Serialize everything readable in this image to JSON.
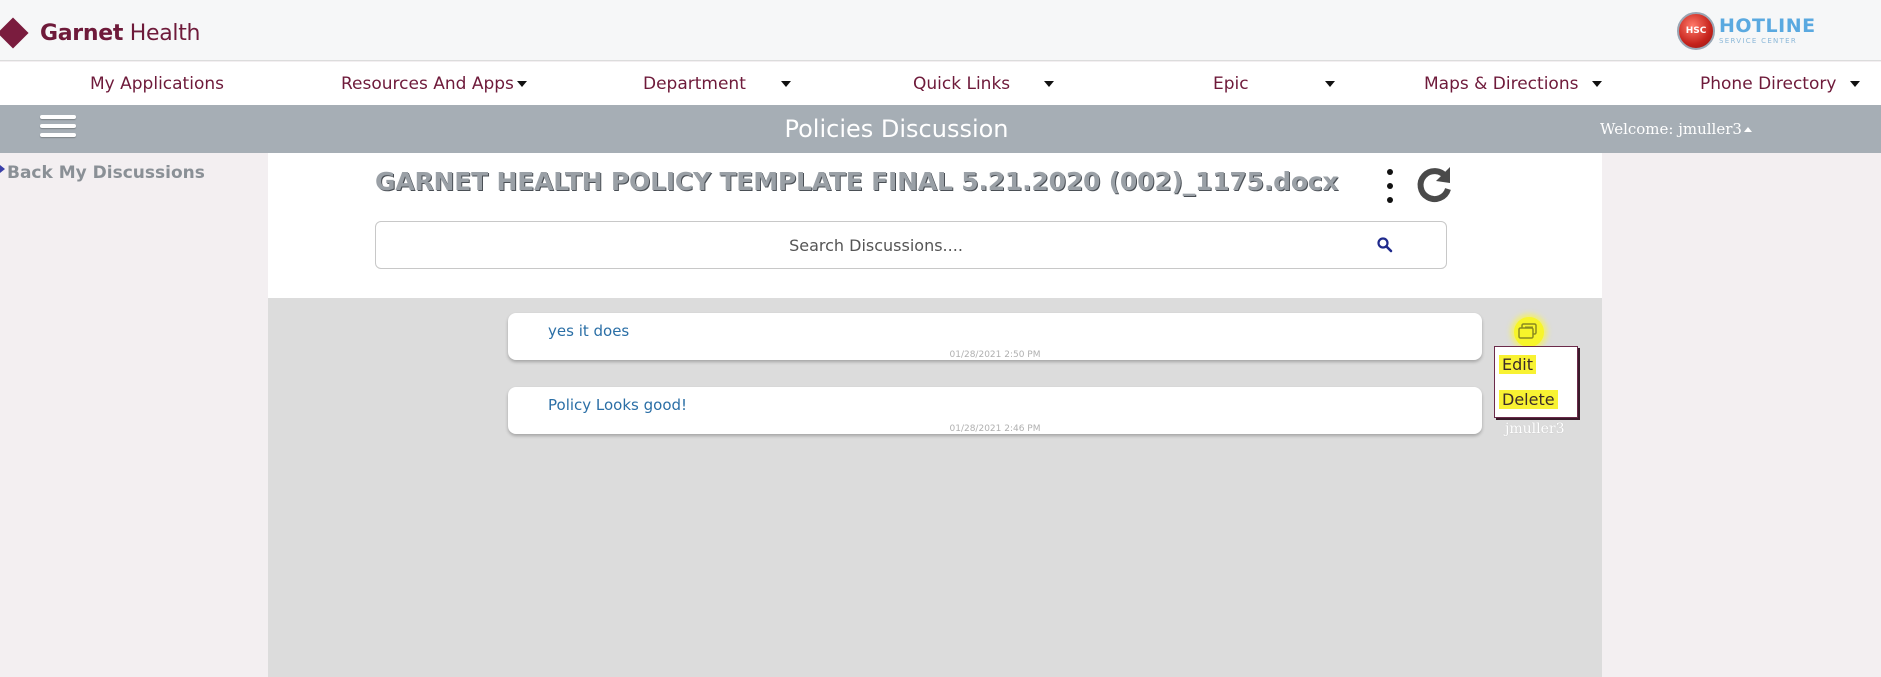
{
  "brand": {
    "name_bold": "Garnet",
    "name_rest": " Health"
  },
  "hotline": {
    "badge": "HSC",
    "title": "HOTLINE",
    "subtitle": "SERVICE CENTER"
  },
  "nav": {
    "items": [
      {
        "label": "My Applications"
      },
      {
        "label": "Resources And Apps"
      },
      {
        "label": "Department"
      },
      {
        "label": "Quick Links"
      },
      {
        "label": "Epic"
      },
      {
        "label": "Maps & Directions"
      },
      {
        "label": "Phone Directory"
      }
    ]
  },
  "titlebar": {
    "title": "Policies Discussion",
    "welcome": "Welcome: jmuller3"
  },
  "sidebar": {
    "back_label": "Back My Discussions"
  },
  "document": {
    "title": "GARNET HEALTH POLICY TEMPLATE FINAL 5.21.2020 (002)_1175.docx"
  },
  "search": {
    "placeholder": "Search Discussions...."
  },
  "messages": [
    {
      "text": "yes it does",
      "time": "01/28/2021 2:50 PM"
    },
    {
      "text": "Policy Looks good!",
      "time": "01/28/2021 2:46 PM"
    }
  ],
  "context_menu": {
    "edit": "Edit",
    "delete": "Delete"
  },
  "user": {
    "name": "jmuller3"
  },
  "colors": {
    "brand": "#6e1a3a",
    "titlebar": "#a6aeb5",
    "highlight": "#f8f232",
    "message_text": "#2b6fa6"
  }
}
